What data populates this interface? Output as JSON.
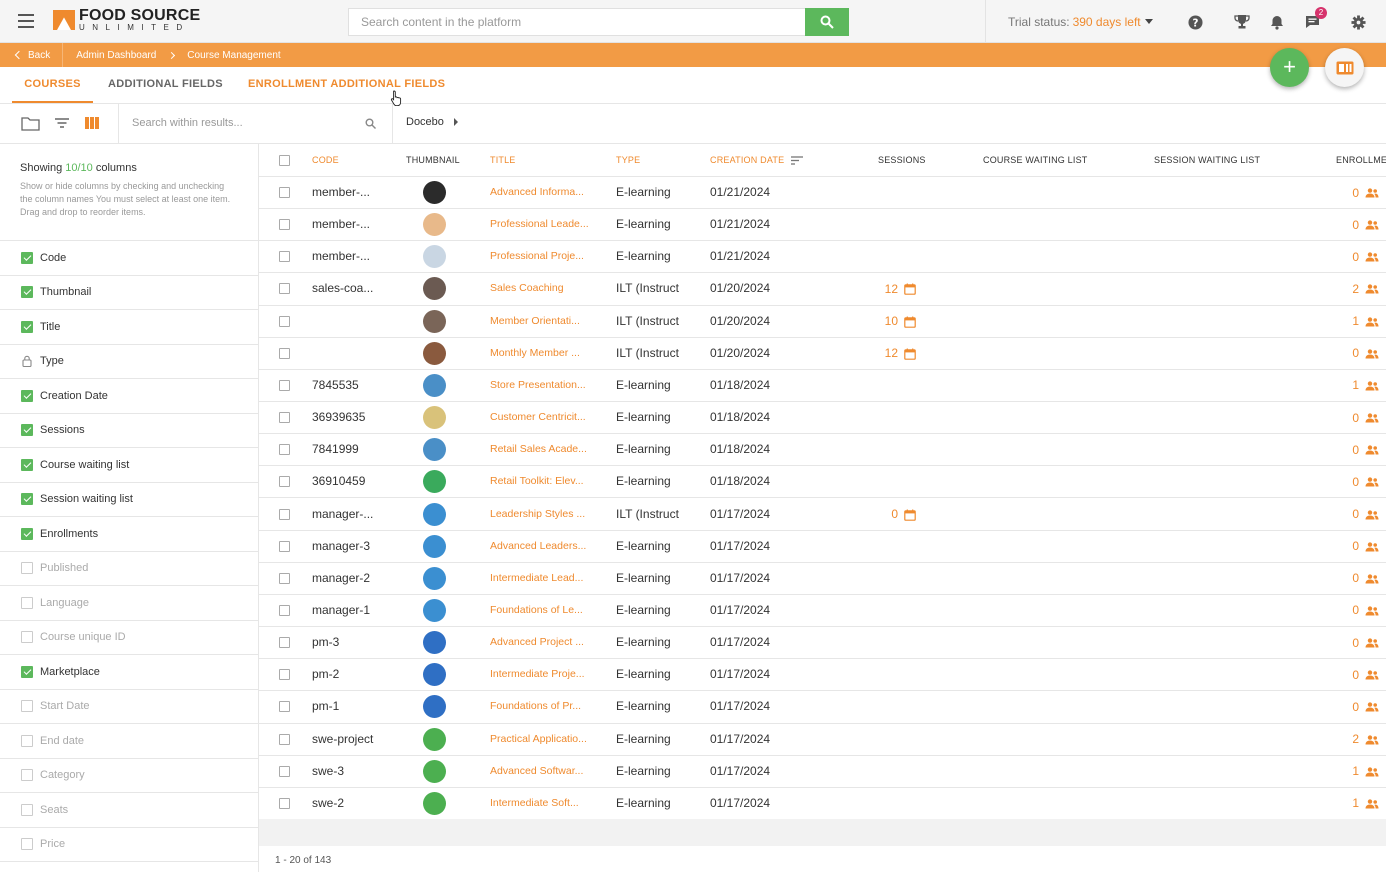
{
  "header": {
    "logo_main": "FOOD SOURCE",
    "logo_sub": "UNLIMITED",
    "search_placeholder": "Search content in the platform",
    "trial_label": "Trial status:",
    "trial_days": "390 days left",
    "messages_badge": "2"
  },
  "breadcrumb": {
    "back": "Back",
    "items": [
      "Admin Dashboard",
      "Course Management"
    ]
  },
  "tabs": [
    "COURSES",
    "ADDITIONAL FIELDS",
    "ENROLLMENT ADDITIONAL FIELDS"
  ],
  "toolbar": {
    "search_placeholder": "Search within results...",
    "folder": "Docebo"
  },
  "column_panel": {
    "showing_prefix": "Showing",
    "showing_count": "10/10",
    "showing_suffix": "columns",
    "help": "Show or hide columns by checking and unchecking the column names You must select at least one item. Drag and drop to reorder items.",
    "items": [
      {
        "label": "Code",
        "state": "on"
      },
      {
        "label": "Thumbnail",
        "state": "on"
      },
      {
        "label": "Title",
        "state": "on"
      },
      {
        "label": "Type",
        "state": "locked"
      },
      {
        "label": "Creation Date",
        "state": "on"
      },
      {
        "label": "Sessions",
        "state": "on"
      },
      {
        "label": "Course waiting list",
        "state": "on"
      },
      {
        "label": "Session waiting list",
        "state": "on"
      },
      {
        "label": "Enrollments",
        "state": "on"
      },
      {
        "label": "Published",
        "state": "off"
      },
      {
        "label": "Language",
        "state": "off"
      },
      {
        "label": "Course unique ID",
        "state": "off"
      },
      {
        "label": "Marketplace",
        "state": "on"
      },
      {
        "label": "Start Date",
        "state": "off"
      },
      {
        "label": "End date",
        "state": "off"
      },
      {
        "label": "Category",
        "state": "off"
      },
      {
        "label": "Seats",
        "state": "off"
      },
      {
        "label": "Price",
        "state": "off"
      }
    ]
  },
  "table": {
    "headers": {
      "code": "CODE",
      "thumbnail": "THUMBNAIL",
      "title": "TITLE",
      "type": "TYPE",
      "creation_date": "CREATION DATE",
      "sessions": "SESSIONS",
      "course_waiting_list": "COURSE WAITING LIST",
      "session_waiting_list": "SESSION WAITING LIST",
      "enrollments": "ENROLLMENTS"
    },
    "rows": [
      {
        "code": "member-...",
        "title": "Advanced Informa...",
        "type": "E-learning",
        "date": "01/21/2024",
        "sessions": "",
        "enrollments": "0",
        "thumb": "#2b2b2b"
      },
      {
        "code": "member-...",
        "title": "Professional Leade...",
        "type": "E-learning",
        "date": "01/21/2024",
        "sessions": "",
        "enrollments": "0",
        "thumb": "#e8b98a"
      },
      {
        "code": "member-...",
        "title": "Professional Proje...",
        "type": "E-learning",
        "date": "01/21/2024",
        "sessions": "",
        "enrollments": "0",
        "thumb": "#c9d6e3"
      },
      {
        "code": "sales-coa...",
        "title": "Sales Coaching",
        "type": "ILT (Instruct",
        "date": "01/20/2024",
        "sessions": "12",
        "enrollments": "2",
        "thumb": "#6b5a52"
      },
      {
        "code": "",
        "title": "Member Orientati...",
        "type": "ILT (Instruct",
        "date": "01/20/2024",
        "sessions": "10",
        "enrollments": "1",
        "thumb": "#7a6558"
      },
      {
        "code": "",
        "title": "Monthly Member ...",
        "type": "ILT (Instruct",
        "date": "01/20/2024",
        "sessions": "12",
        "enrollments": "0",
        "thumb": "#8a5a3e"
      },
      {
        "code": "7845535",
        "title": "Store Presentation...",
        "type": "E-learning",
        "date": "01/18/2024",
        "sessions": "",
        "enrollments": "1",
        "thumb": "#4a8fc7"
      },
      {
        "code": "36939635",
        "title": "Customer Centricit...",
        "type": "E-learning",
        "date": "01/18/2024",
        "sessions": "",
        "enrollments": "0",
        "thumb": "#d9c27a"
      },
      {
        "code": "7841999",
        "title": "Retail Sales Acade...",
        "type": "E-learning",
        "date": "01/18/2024",
        "sessions": "",
        "enrollments": "0",
        "thumb": "#4a8fc7"
      },
      {
        "code": "36910459",
        "title": "Retail Toolkit: Elev...",
        "type": "E-learning",
        "date": "01/18/2024",
        "sessions": "",
        "enrollments": "0",
        "thumb": "#3aaa5c"
      },
      {
        "code": "manager-...",
        "title": "Leadership Styles ...",
        "type": "ILT (Instruct",
        "date": "01/17/2024",
        "sessions": "0",
        "enrollments": "0",
        "thumb": "#3b8fd1"
      },
      {
        "code": "manager-3",
        "title": "Advanced Leaders...",
        "type": "E-learning",
        "date": "01/17/2024",
        "sessions": "",
        "enrollments": "0",
        "thumb": "#3b8fd1"
      },
      {
        "code": "manager-2",
        "title": "Intermediate Lead...",
        "type": "E-learning",
        "date": "01/17/2024",
        "sessions": "",
        "enrollments": "0",
        "thumb": "#3b8fd1"
      },
      {
        "code": "manager-1",
        "title": "Foundations of Le...",
        "type": "E-learning",
        "date": "01/17/2024",
        "sessions": "",
        "enrollments": "0",
        "thumb": "#3b8fd1"
      },
      {
        "code": "pm-3",
        "title": "Advanced Project ...",
        "type": "E-learning",
        "date": "01/17/2024",
        "sessions": "",
        "enrollments": "0",
        "thumb": "#2f6fc4"
      },
      {
        "code": "pm-2",
        "title": "Intermediate Proje...",
        "type": "E-learning",
        "date": "01/17/2024",
        "sessions": "",
        "enrollments": "0",
        "thumb": "#2f6fc4"
      },
      {
        "code": "pm-1",
        "title": "Foundations of Pr...",
        "type": "E-learning",
        "date": "01/17/2024",
        "sessions": "",
        "enrollments": "0",
        "thumb": "#2f6fc4"
      },
      {
        "code": "swe-project",
        "title": "Practical Applicatio...",
        "type": "E-learning",
        "date": "01/17/2024",
        "sessions": "",
        "enrollments": "2",
        "thumb": "#4caf50"
      },
      {
        "code": "swe-3",
        "title": "Advanced Softwar...",
        "type": "E-learning",
        "date": "01/17/2024",
        "sessions": "",
        "enrollments": "1",
        "thumb": "#4caf50"
      },
      {
        "code": "swe-2",
        "title": "Intermediate Soft...",
        "type": "E-learning",
        "date": "01/17/2024",
        "sessions": "",
        "enrollments": "1",
        "thumb": "#4caf50"
      }
    ],
    "pager": "1 - 20 of 143"
  },
  "colors": {
    "accent": "#ef8a2e",
    "green": "#5cb85c",
    "crumb_bar": "#f29b45"
  }
}
